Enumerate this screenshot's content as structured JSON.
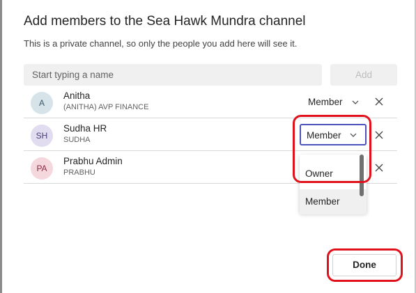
{
  "dialog": {
    "title": "Add members to the Sea Hawk Mundra channel",
    "subtitle": "This is a private channel, so only the people you add here will see it."
  },
  "search": {
    "placeholder": "Start typing a name",
    "add_label": "Add"
  },
  "members": [
    {
      "initials": "A",
      "name": "Anitha",
      "sub": "(ANITHA) AVP FINANCE",
      "role": "Member",
      "avatar_bg": "#d6e4ea",
      "avatar_fg": "#3a5a6a"
    },
    {
      "initials": "SH",
      "name": "Sudha HR",
      "sub": "SUDHA",
      "role": "Member",
      "avatar_bg": "#e1dcef",
      "avatar_fg": "#4a3f7a"
    },
    {
      "initials": "PA",
      "name": "Prabhu Admin",
      "sub": "PRABHU",
      "role": "",
      "avatar_bg": "#f5d7de",
      "avatar_fg": "#8a2a42"
    }
  ],
  "role_dropdown": {
    "options": [
      "Owner",
      "Member"
    ]
  },
  "footer": {
    "done_label": "Done"
  },
  "colors": {
    "accent": "#4b53bc",
    "highlight": "#e0111b"
  }
}
